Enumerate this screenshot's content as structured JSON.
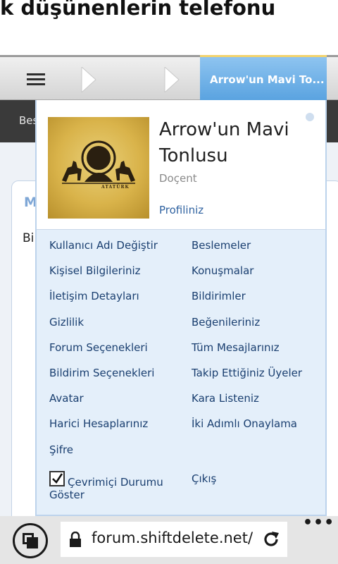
{
  "page": {
    "headline": "k düşünenlerin telefonu"
  },
  "navbar": {
    "menu_icon": "hamburger-icon",
    "breadcrumb_icons": [
      "chevron-right-icon",
      "chevron-right-icon"
    ],
    "user_tab": "Arrow'un Mavi To..."
  },
  "subnav": {
    "label": "Bese"
  },
  "background": {
    "box_letter": "M",
    "text_start": "Bi"
  },
  "profile": {
    "name": "Arrow'un Mavi Tonlusu",
    "title": "Doçent",
    "profile_link": "Profiliniz",
    "avatar_caption": "ATATÜRK"
  },
  "menu": {
    "left": [
      "Kullanıcı Adı Değiştir",
      "Kişisel Bilgileriniz",
      "İletişim Detayları",
      "Gizlilik",
      "Forum Seçenekleri",
      "Bildirim Seçenekleri",
      "Avatar",
      "Harici Hesaplarınız",
      "Şifre"
    ],
    "right": [
      "Beslemeler",
      "Konuşmalar",
      "Bildirimler",
      "Beğenileriniz",
      "Tüm Mesajlarınız",
      "Takip Ettiğiniz Üyeler",
      "Kara Listeniz",
      "İki Adımlı Onaylama"
    ],
    "online_status": {
      "line1": "Çevrimiçi Durumu",
      "line2": "Göster",
      "checked": true
    },
    "logout": "Çıkış"
  },
  "browser": {
    "url": "forum.shiftdelete.net/",
    "tabs_icon": "tabs-icon",
    "lock_icon": "lock-icon",
    "refresh_icon": "refresh-icon",
    "more_icon": "more-dots-icon",
    "more_glyph": "•••"
  },
  "colors": {
    "link": "#1a3f70",
    "nav_active": "#5aa3e0",
    "nav_active_top": "#f3d36d",
    "subnav": "#3a3a3a"
  }
}
